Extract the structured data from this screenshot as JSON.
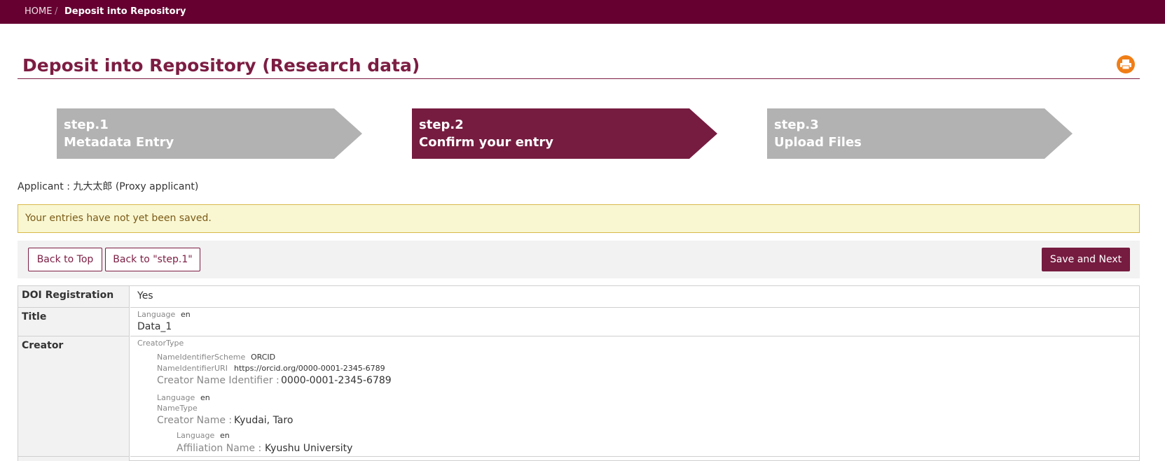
{
  "breadcrumb": {
    "home": "HOME",
    "separator": "/",
    "current": "Deposit into Repository"
  },
  "page": {
    "title": "Deposit into Repository (Research data)",
    "print_icon": "printer-icon",
    "print_color": "#f07e17"
  },
  "steps": [
    {
      "number": "step.1",
      "label": "Metadata Entry",
      "state": "inactive"
    },
    {
      "number": "step.2",
      "label": "Confirm your entry",
      "state": "active"
    },
    {
      "number": "step.3",
      "label": "Upload Files",
      "state": "inactive"
    }
  ],
  "applicant": "Applicant : 九大太郎 (Proxy applicant)",
  "notice": "Your entries have not yet been saved.",
  "actions": {
    "back_top": "Back to Top",
    "back_step1": "Back to \"step.1\"",
    "save_next": "Save and Next"
  },
  "colors": {
    "brand": "#650030",
    "accent": "#761c40",
    "notice_bg": "#f9f7d2"
  },
  "fields": {
    "doi": {
      "label": "DOI Registration",
      "value": "Yes"
    },
    "title": {
      "label": "Title",
      "lang_label": "Language",
      "lang": "en",
      "value": "Data_1"
    },
    "creator": {
      "label": "Creator",
      "creator_type": "CreatorType",
      "scheme_label": "NameIdentifierScheme",
      "scheme": "ORCID",
      "uri_label": "NameIdentifierURI",
      "uri": "https://orcid.org/0000-0001-2345-6789",
      "identifier_label": "Creator Name Identifier :",
      "identifier": "0000-0001-2345-6789",
      "lang_label": "Language",
      "lang": "en",
      "name_type": "NameType",
      "name_label": "Creator Name :",
      "name": "Kyudai, Taro",
      "aff_lang_label": "Language",
      "aff_lang": "en",
      "aff_label": "Affiliation Name :",
      "aff": "Kyushu University"
    }
  }
}
